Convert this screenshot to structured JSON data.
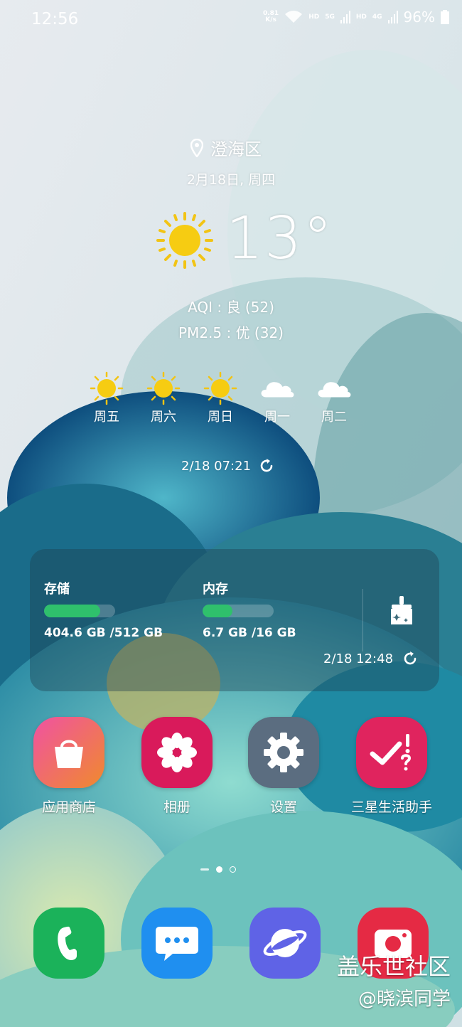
{
  "status_bar": {
    "time": "12:56",
    "net_speed_value": "0.81",
    "net_speed_unit": "K/s",
    "hd1": "HD",
    "net1": "5G",
    "hd2": "HD",
    "net2": "4G",
    "battery_percent": "96%"
  },
  "weather": {
    "location": "澄海区",
    "date": "2月18日, 周四",
    "temperature": "13°",
    "aqi": "AQI : 良 (52)",
    "pm25": "PM2.5 : 优 (32)",
    "forecast": [
      {
        "day": "周五",
        "icon": "sun-icon"
      },
      {
        "day": "周六",
        "icon": "sun-icon"
      },
      {
        "day": "周日",
        "icon": "sun-icon"
      },
      {
        "day": "周一",
        "icon": "cloud-icon"
      },
      {
        "day": "周二",
        "icon": "cloud-icon"
      }
    ],
    "updated": "2/18 07:21"
  },
  "device_care": {
    "storage_label": "存储",
    "storage_value": "404.6 GB /512 GB",
    "storage_used_fraction": 0.79,
    "memory_label": "内存",
    "memory_value": "6.7 GB /16 GB",
    "memory_used_fraction": 0.42,
    "updated": "2/18 12:48",
    "accent_color": "#2fc06c"
  },
  "apps": [
    {
      "label": "应用商店",
      "icon": "store-bag-icon",
      "color": "#e8428f"
    },
    {
      "label": "相册",
      "icon": "gallery-flower-icon",
      "color": "#d91a5b"
    },
    {
      "label": "设置",
      "icon": "gear-icon",
      "color": "#5b6d80"
    },
    {
      "label": "三星生活助手",
      "icon": "samsung-members-icon",
      "color": "#e0245e"
    }
  ],
  "dock": [
    {
      "icon": "phone-icon",
      "color": "#1bb25a"
    },
    {
      "icon": "messages-icon",
      "color": "#1f8ff0"
    },
    {
      "icon": "internet-icon",
      "color": "#5f63e6"
    },
    {
      "icon": "camera-icon",
      "color": "#e52a44"
    }
  ],
  "watermark": {
    "line1": "盖乐世社区",
    "line2": "@晓滨同学"
  }
}
